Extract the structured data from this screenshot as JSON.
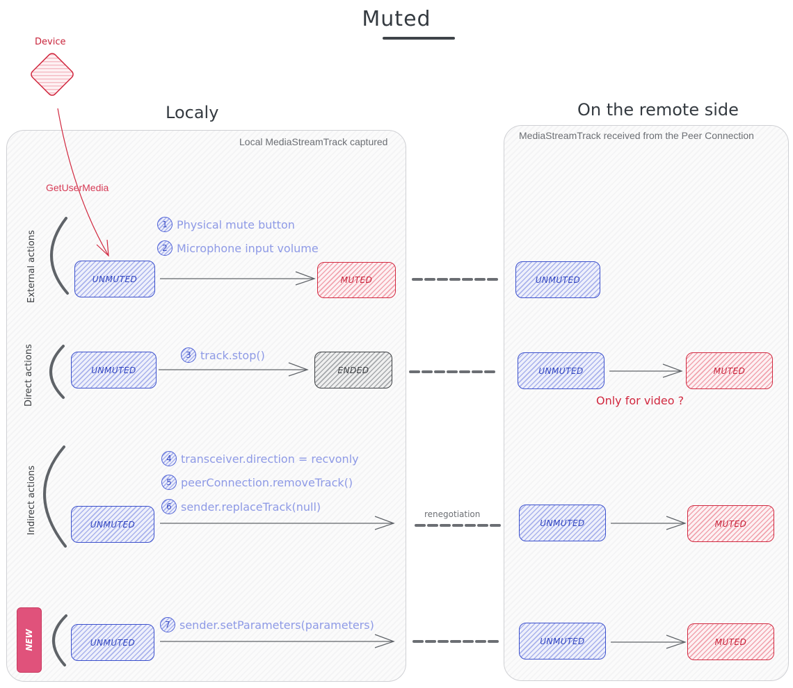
{
  "title": "Muted",
  "device": {
    "label": "Device",
    "arrow_label": "GetUserMedia",
    "color": "#d1283f"
  },
  "local": {
    "heading": "Localy",
    "caption": "Local MediaStreamTrack captured"
  },
  "remote": {
    "heading": "On the remote side",
    "caption": "MediaStreamTrack received from the Peer Connection"
  },
  "colors": {
    "unmuted": "#3b50cc",
    "muted": "#d1283f",
    "ended": "#3a3d40",
    "action_text": "#8e9ae6",
    "new_tag": "#e0527b"
  },
  "rows": [
    {
      "group": "External actions",
      "local_from": "UNMUTED",
      "local_to": "MUTED",
      "actions": [
        {
          "num": "1",
          "text": "Physical mute button"
        },
        {
          "num": "2",
          "text": "Microphone input volume"
        }
      ],
      "link_label": "",
      "remote_from": "UNMUTED",
      "remote_to": ""
    },
    {
      "group": "Direct actions",
      "local_from": "UNMUTED",
      "local_to": "ENDED",
      "actions": [
        {
          "num": "3",
          "text": "track.stop()"
        }
      ],
      "link_label": "",
      "remote_from": "UNMUTED",
      "remote_to": "MUTED",
      "note": "Only for video ?"
    },
    {
      "group": "Indirect actions",
      "local_from": "UNMUTED",
      "local_to": "",
      "actions": [
        {
          "num": "4",
          "text": "transceiver.direction = recvonly"
        },
        {
          "num": "5",
          "text": "peerConnection.removeTrack()"
        },
        {
          "num": "6",
          "text": "sender.replaceTrack(null)"
        }
      ],
      "link_label": "renegotiation",
      "remote_from": "UNMUTED",
      "remote_to": "MUTED"
    },
    {
      "group": "NEW",
      "local_from": "UNMUTED",
      "local_to": "",
      "actions": [
        {
          "num": "7",
          "text": "sender.setParameters(parameters)"
        }
      ],
      "link_label": "",
      "remote_from": "UNMUTED",
      "remote_to": "MUTED"
    }
  ]
}
